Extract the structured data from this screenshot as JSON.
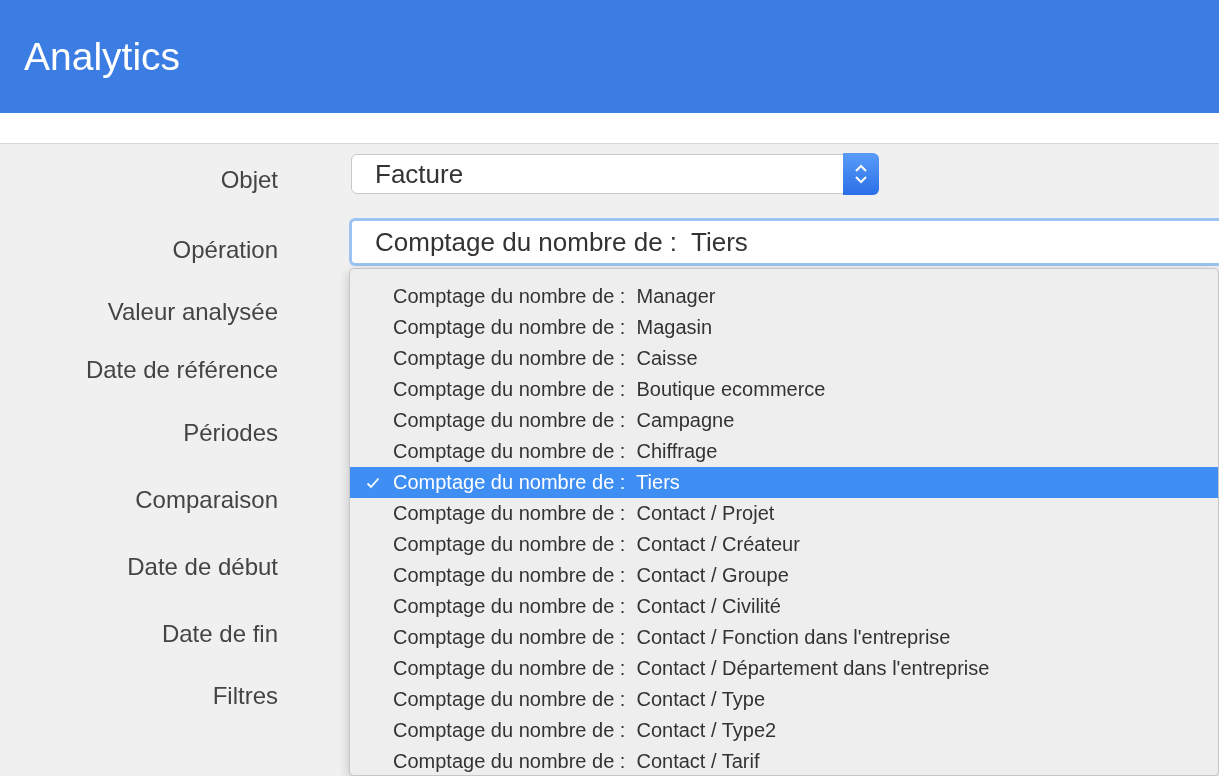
{
  "header": {
    "title": "Analytics"
  },
  "form": {
    "labels": [
      "Objet",
      "Opération",
      "Valeur analysée",
      "Date de référence",
      "Périodes",
      "Comparaison",
      "Date de début",
      "Date de fin",
      "Filtres"
    ],
    "object_select": {
      "value": "Facture"
    },
    "operation_select": {
      "value": "Comptage du nombre de :  Tiers",
      "focused": true
    }
  },
  "dropdown": {
    "options": [
      {
        "label": "Comptage du nombre de :  Manager",
        "selected": false
      },
      {
        "label": "Comptage du nombre de :  Magasin",
        "selected": false
      },
      {
        "label": "Comptage du nombre de :  Caisse",
        "selected": false
      },
      {
        "label": "Comptage du nombre de :  Boutique ecommerce",
        "selected": false
      },
      {
        "label": "Comptage du nombre de :  Campagne",
        "selected": false
      },
      {
        "label": "Comptage du nombre de :  Chiffrage",
        "selected": false
      },
      {
        "label": "Comptage du nombre de :  Tiers",
        "selected": true
      },
      {
        "label": "Comptage du nombre de :  Contact / Projet",
        "selected": false
      },
      {
        "label": "Comptage du nombre de :  Contact / Créateur",
        "selected": false
      },
      {
        "label": "Comptage du nombre de :  Contact / Groupe",
        "selected": false
      },
      {
        "label": "Comptage du nombre de :  Contact / Civilité",
        "selected": false
      },
      {
        "label": "Comptage du nombre de :  Contact / Fonction dans l'entreprise",
        "selected": false
      },
      {
        "label": "Comptage du nombre de :  Contact / Département dans l'entreprise",
        "selected": false
      },
      {
        "label": "Comptage du nombre de :  Contact / Type",
        "selected": false
      },
      {
        "label": "Comptage du nombre de :  Contact / Type2",
        "selected": false
      },
      {
        "label": "Comptage du nombre de :  Contact / Tarif",
        "selected": false
      }
    ]
  }
}
